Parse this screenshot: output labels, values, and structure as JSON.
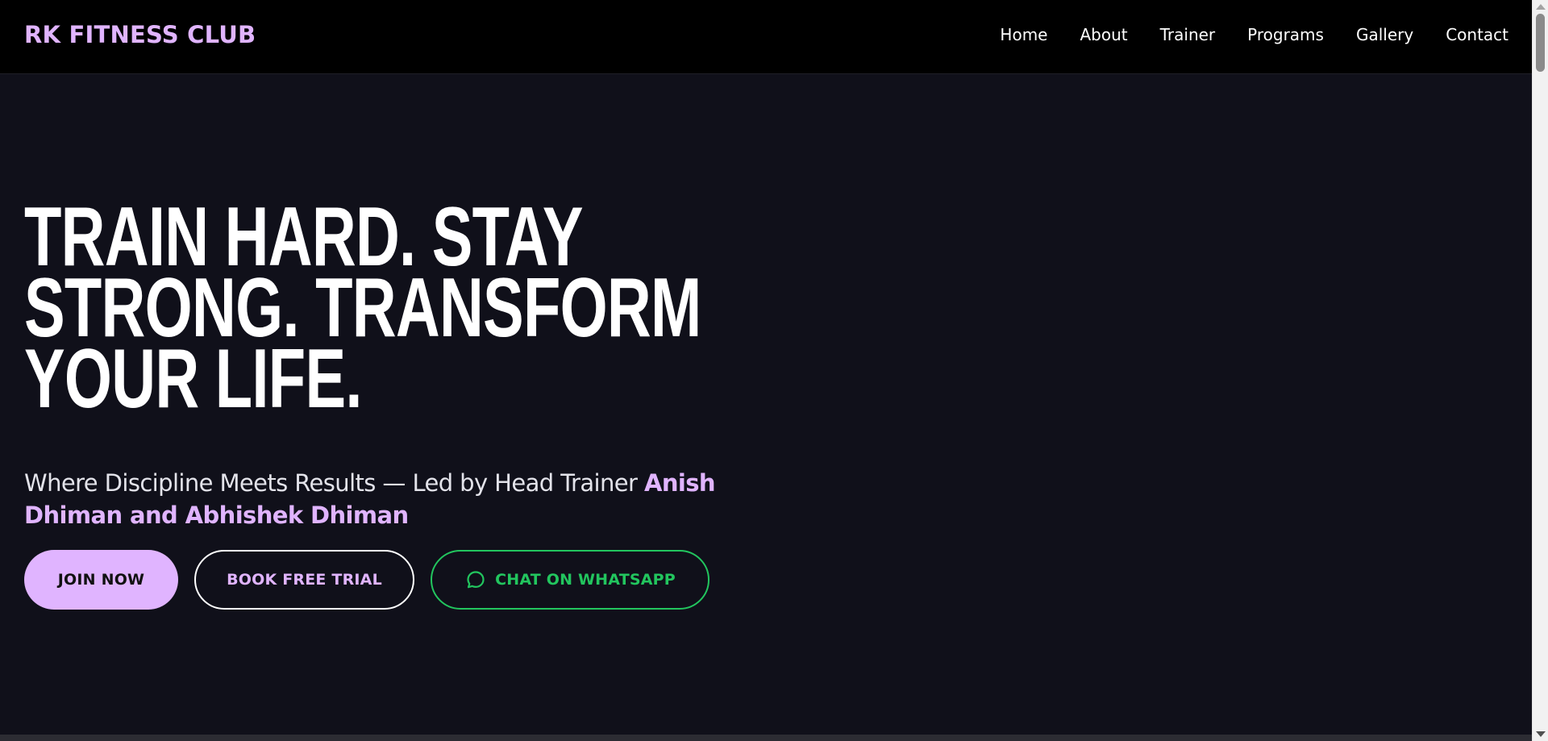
{
  "colors": {
    "accent": "#e0b4ff",
    "background": "#10101a",
    "navbar": "#000000",
    "whatsapp": "#22c55e",
    "text": "#ffffff"
  },
  "brand": {
    "name": "RK FITNESS CLUB"
  },
  "nav": {
    "items": [
      {
        "label": "Home"
      },
      {
        "label": "About"
      },
      {
        "label": "Trainer"
      },
      {
        "label": "Programs"
      },
      {
        "label": "Gallery"
      },
      {
        "label": "Contact"
      }
    ]
  },
  "hero": {
    "headline_lines": [
      "TRAIN HARD. STAY",
      "STRONG. TRANSFORM",
      "YOUR LIFE."
    ],
    "tagline_prefix": "Where Discipline Meets Results — Led by Head Trainer",
    "tagline_highlight": "Anish Dhiman and Abhishek Dhiman"
  },
  "cta": {
    "join_label": "JOIN NOW",
    "trial_label": "BOOK FREE TRIAL",
    "whatsapp_label": "CHAT ON WHATSAPP",
    "whatsapp_icon": "chat-bubble-icon"
  }
}
